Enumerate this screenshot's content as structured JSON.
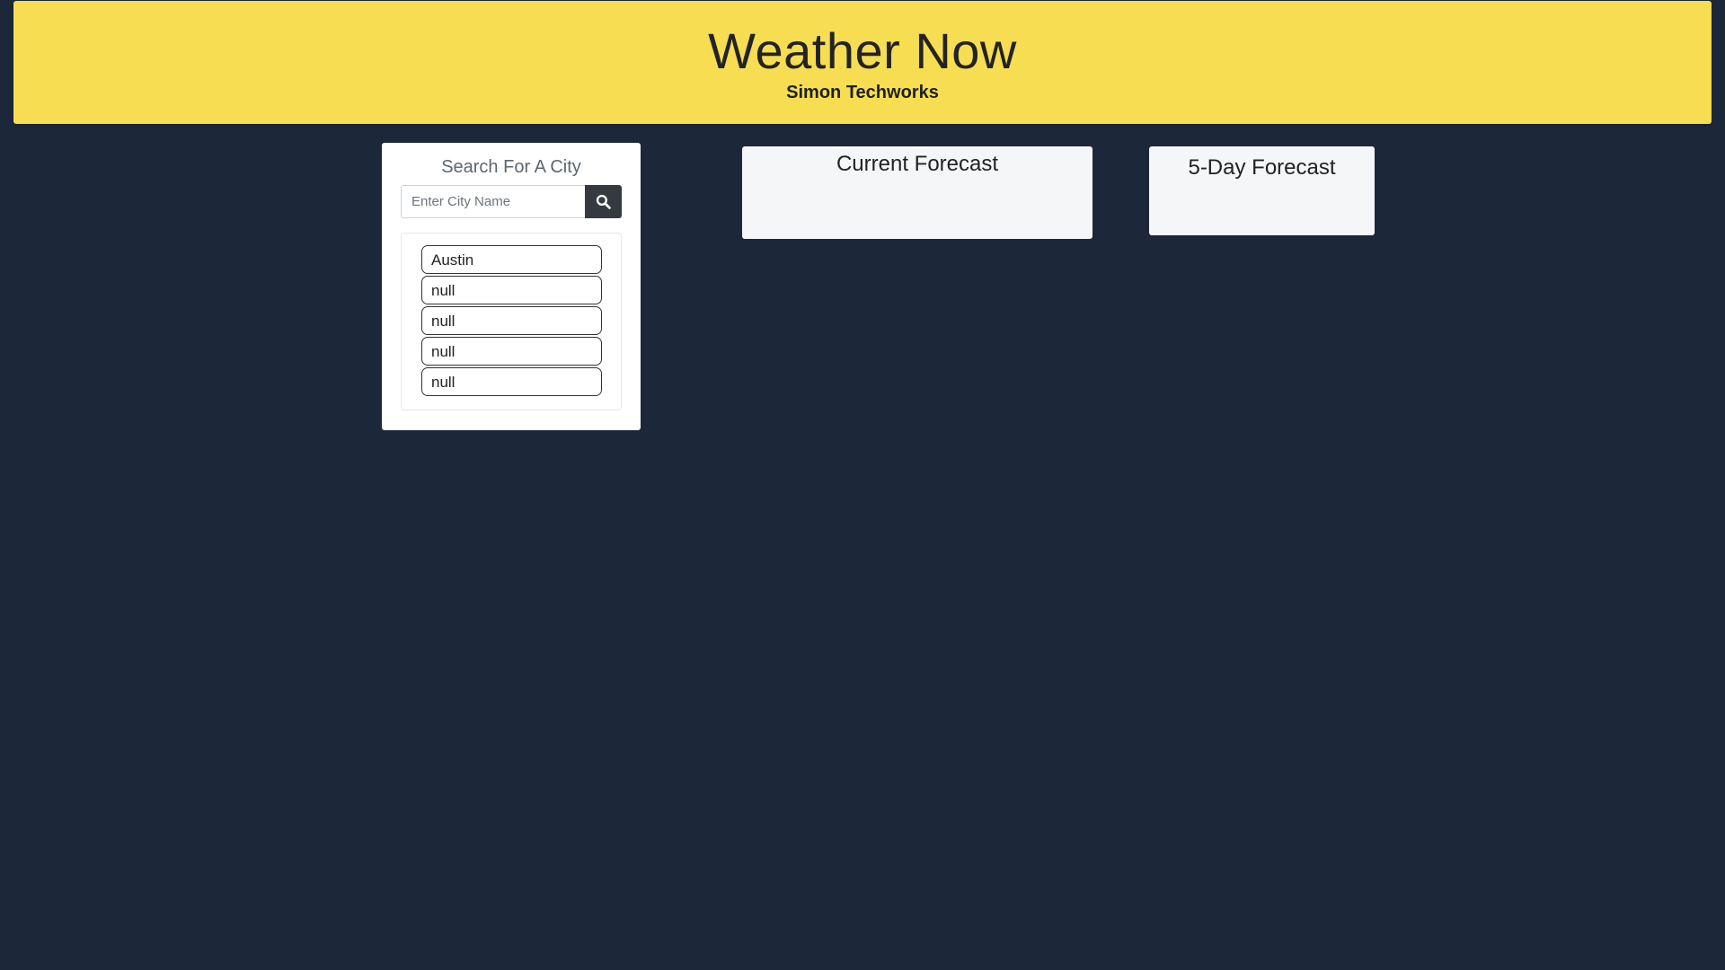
{
  "header": {
    "title": "Weather Now",
    "subtitle": "Simon Techworks",
    "background_color": "#f6dd52"
  },
  "search": {
    "title": "Search For A City",
    "placeholder": "Enter City Name",
    "value": "",
    "button_icon": "search-icon"
  },
  "history": {
    "items": [
      {
        "label": "Austin"
      },
      {
        "label": "null"
      },
      {
        "label": "null"
      },
      {
        "label": "null"
      },
      {
        "label": "null"
      }
    ]
  },
  "current_forecast": {
    "title": "Current Forecast"
  },
  "five_day_forecast": {
    "title": "5-Day Forecast"
  },
  "colors": {
    "page_background": "#1c2839",
    "card_background": "#f5f6f8",
    "button_dark": "#343a40"
  }
}
